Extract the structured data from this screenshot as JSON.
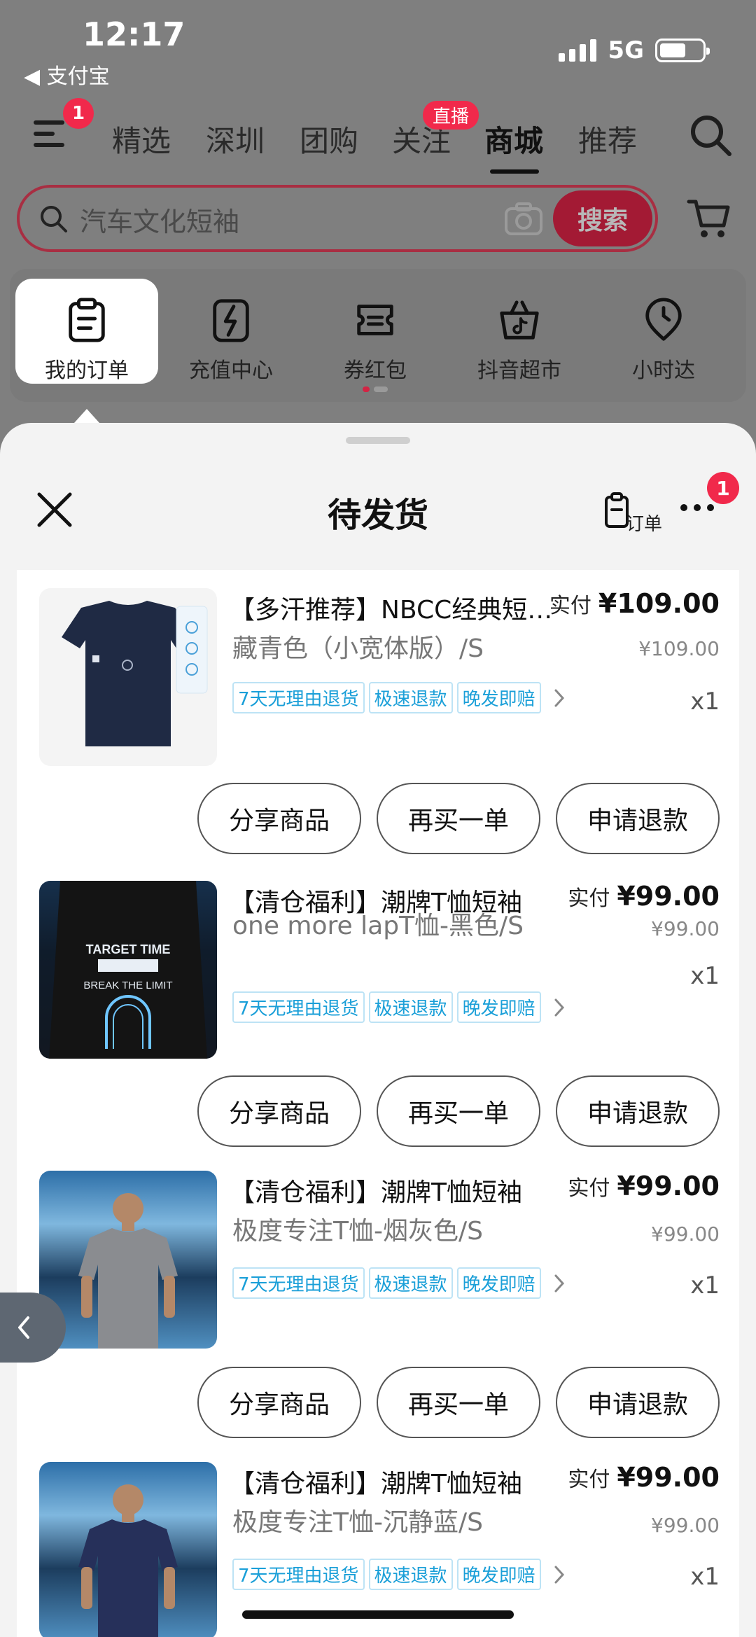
{
  "status": {
    "time": "12:17",
    "back_app": "◀ 支付宝",
    "network": "5G"
  },
  "nav": {
    "menu_badge": "1",
    "tabs": [
      "精选",
      "深圳",
      "团购",
      "关注",
      "商城",
      "推荐"
    ],
    "active_tab": "商城",
    "live_badge": "直播"
  },
  "search": {
    "placeholder": "汽车文化短袖",
    "button": "搜索"
  },
  "quick_links": [
    "我的订单",
    "充值中心",
    "券红包",
    "抖音超市",
    "小时达"
  ],
  "sheet": {
    "title": "待发货",
    "order_label": "订单",
    "more_badge": "1",
    "paid_label": "实付"
  },
  "items": [
    {
      "title": "【多汗推荐】NBCC经典短袖T恤",
      "price": "¥109.00",
      "original": "¥109.00",
      "spec": "藏青色（小宽体版）/S",
      "tags": [
        "7天无理由退货",
        "极速退款",
        "晚发即赔"
      ],
      "qty": "x1",
      "actions": [
        "分享商品",
        "再买一单",
        "申请退款"
      ]
    },
    {
      "title": "【清仓福利】潮牌T恤短袖",
      "price": "¥99.00",
      "original": "¥99.00",
      "spec": "one more lapT恤-黑色/S",
      "tags": [
        "7天无理由退货",
        "极速退款",
        "晚发即赔"
      ],
      "qty": "x1",
      "actions": [
        "分享商品",
        "再买一单",
        "申请退款"
      ]
    },
    {
      "title": "【清仓福利】潮牌T恤短袖",
      "price": "¥99.00",
      "original": "¥99.00",
      "spec": "极度专注T恤-烟灰色/S",
      "tags": [
        "7天无理由退货",
        "极速退款",
        "晚发即赔"
      ],
      "qty": "x1",
      "actions": [
        "分享商品",
        "再买一单",
        "申请退款"
      ]
    },
    {
      "title": "【清仓福利】潮牌T恤短袖",
      "price": "¥99.00",
      "original": "¥99.00",
      "spec": "极度专注T恤-沉静蓝/S",
      "tags": [
        "7天无理由退货",
        "极速退款",
        "晚发即赔"
      ],
      "qty": "x1",
      "actions": []
    }
  ],
  "thumb_text": {
    "target": "TARGET TIME",
    "limit": "BREAK THE LIMIT"
  },
  "colors": {
    "accent": "#f1294b",
    "tag_blue": "#1a9fd8",
    "navy_tee": "#1f2a44"
  }
}
